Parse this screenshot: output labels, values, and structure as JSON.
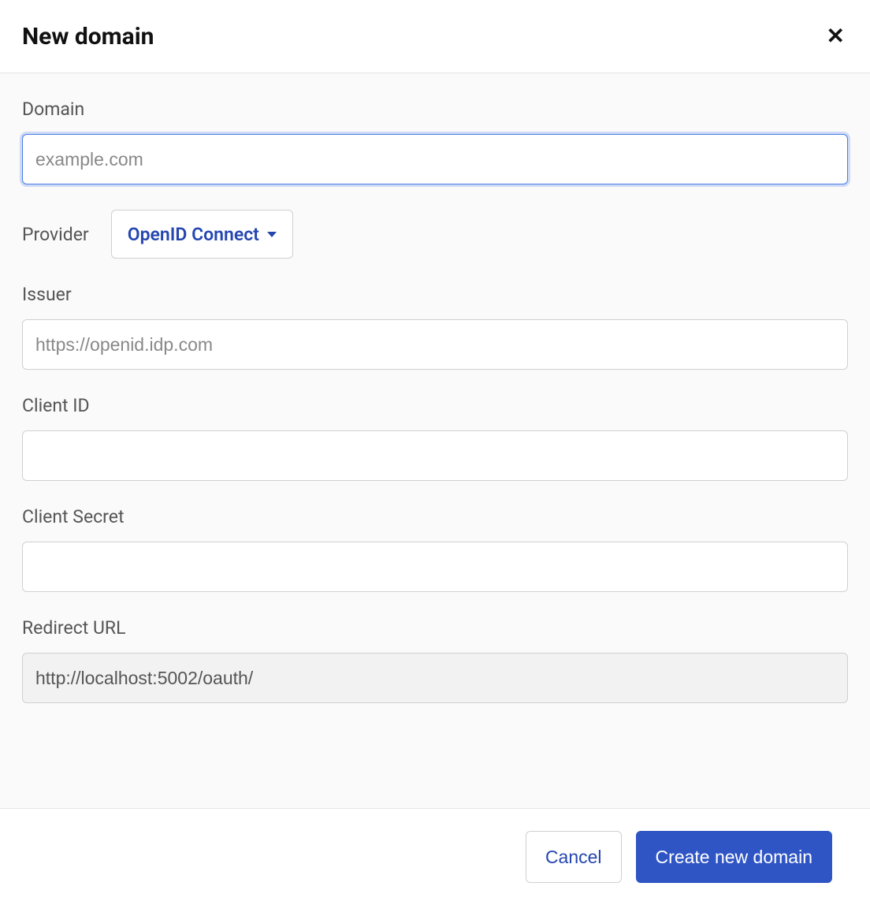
{
  "header": {
    "title": "New domain"
  },
  "form": {
    "domain": {
      "label": "Domain",
      "placeholder": "example.com",
      "value": ""
    },
    "provider": {
      "label": "Provider",
      "selected": "OpenID Connect"
    },
    "issuer": {
      "label": "Issuer",
      "placeholder": "https://openid.idp.com",
      "value": ""
    },
    "client_id": {
      "label": "Client ID",
      "value": ""
    },
    "client_secret": {
      "label": "Client Secret",
      "value": ""
    },
    "redirect_url": {
      "label": "Redirect URL",
      "value": "http://localhost:5002/oauth/"
    }
  },
  "footer": {
    "cancel_label": "Cancel",
    "submit_label": "Create new domain"
  }
}
